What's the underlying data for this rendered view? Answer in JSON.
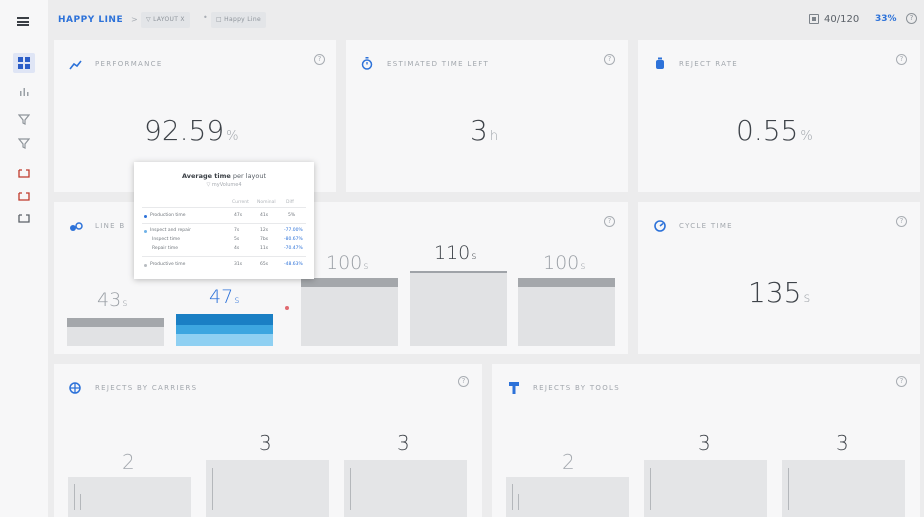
{
  "header": {
    "title": "HAPPY LINE",
    "sep": ">",
    "chip_layout": "▽ LAYOUT X",
    "chip_line": "□ Happy Line",
    "chip_dot": "•",
    "count": "40/120",
    "percent": "33%",
    "help": "?"
  },
  "cards": {
    "performance": {
      "label": "PERFORMANCE",
      "value": "92.59",
      "unit": "%",
      "help": "?"
    },
    "time_left": {
      "label": "ESTIMATED TIME LEFT",
      "value": "3",
      "unit": "h",
      "help": "?"
    },
    "reject_rate": {
      "label": "REJECT RATE",
      "value": "0.55",
      "unit": "%",
      "help": "?"
    },
    "line_balance": {
      "label": "LINE B",
      "help": "?"
    },
    "cycle_time": {
      "label": "CYCLE TIME",
      "value": "135",
      "unit": "s",
      "help": "?"
    },
    "rejects_carriers": {
      "label": "REJECTS BY CARRIERS",
      "help": "?"
    },
    "rejects_tools": {
      "label": "REJECTS BY TOOLS",
      "help": "?"
    }
  },
  "line_balance_bars": [
    {
      "value": "43",
      "unit": "s"
    },
    {
      "value": "47",
      "unit": "s"
    },
    {
      "value": "100",
      "unit": "s"
    },
    {
      "value": "110",
      "unit": "s"
    },
    {
      "value": "100",
      "unit": "s"
    }
  ],
  "tooltip": {
    "title_bold": "Average time",
    "title_rest": " per layout",
    "subtitle": "▽ myVolume4",
    "headers": [
      "Current",
      "Nominal",
      "Diff"
    ],
    "rows": [
      {
        "label": "Production time",
        "current": "47s",
        "nominal": "41s",
        "diff": "5%"
      },
      {
        "label": "Inspect and repair",
        "current": "7s",
        "nominal": "12s",
        "diff": "-77.00%"
      },
      {
        "label": "Inspect time",
        "current": "5s",
        "nominal": "7bs",
        "diff": "-80.67%"
      },
      {
        "label": "Repair time",
        "current": "4s",
        "nominal": "11s",
        "diff": "-70.47%"
      },
      {
        "label": "Productive time",
        "current": "31s",
        "nominal": "65s",
        "diff": "-48.63%"
      }
    ]
  },
  "carriers_values": [
    "2",
    "3",
    "3"
  ],
  "tools_values": [
    "2",
    "3",
    "3"
  ],
  "colors": {
    "accent": "#2d72d9",
    "bar_blue": "#1e88c9"
  }
}
